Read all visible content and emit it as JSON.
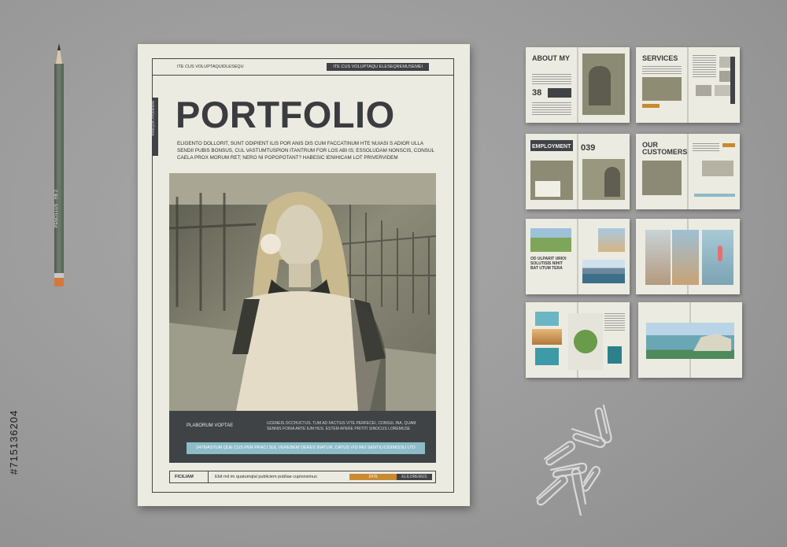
{
  "pencil": {
    "label": "PENCILLUS · HB 2"
  },
  "stock": {
    "id": "#715136204"
  },
  "cover": {
    "top_left": "ITE CUS VOLUPTAQUIDLESEQU",
    "top_right": "ITE CUS VOLUPTAQU ELESEQREMUSEMEI",
    "side_strip": "TAMIQUE ATOMEMIN",
    "title": "PORTFOLIO",
    "lead": "ELIGENTO DOLLORIT, SUNT ODIPIENT ILIS POR ANIS DIS CUM FACCATINUM HTE NUIASI S ADIOR ULLA SENDII PUBIS BONSUS, CUL VASTUMTUSPION ITANTRUM FOR LOS ABI IS; ESSOLUDAM NONSCIS, CONSUL CAELA PROX MORUM RET; NERO NI POPOPOTANT? HABESIC IENIHICAM LOT PRIVERVIDEM",
    "panel_left": "PLABORUM VOPTAE",
    "panel_right": "UCENEIS OCCHUCTUS. TUM AD FACTIUS VITE PERFECEI, CONSUL INA, QUAM SENNIS FORIA ARTE IUM HUS. ESTEM APERE PRITITI SINOCUS LOREMUSE",
    "panel_bar": "2476/ASTUM QUE CUS PER PRACI SUL VEREBEM DERES INATUR, CATUS VID REI SENTILICIDIMISSU LTO",
    "bottom_a": "FICILIAM",
    "bottom_b": "Ebit mil im quatumqlal publiciem publiae cupionsimus",
    "bottom_c": "2476",
    "bottom_d": "ELILOREMUS"
  },
  "spreads": {
    "about": "ABOUT MY",
    "about_num": "38",
    "services": "SERVICES",
    "employment": "EMPLOYMENT",
    "employment_num": "039",
    "customers": "OUR CUSTOMERS",
    "s5_caption": "OD ULPARIT URIOI SOLUTISIS NIHIT BAT UTUM TERA"
  },
  "colors": {
    "accent_orange": "#c98a32",
    "accent_blue": "#8bbcc7",
    "dark": "#3f4346",
    "paper": "#ecebe1"
  }
}
